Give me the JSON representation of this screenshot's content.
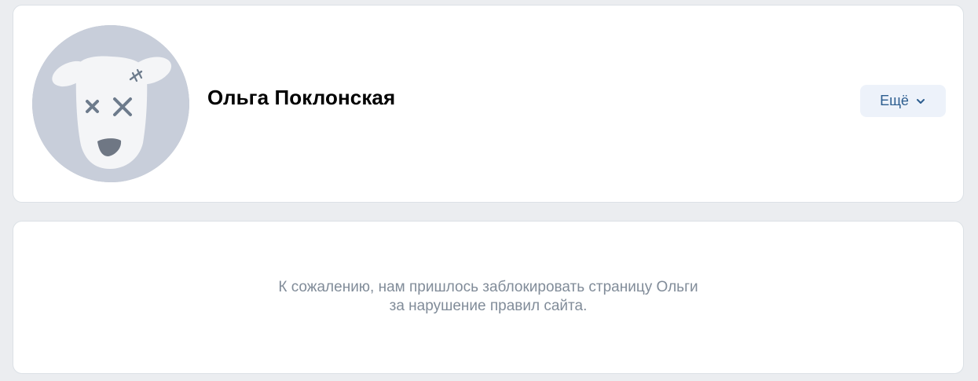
{
  "profile": {
    "name": "Ольга Поклонская",
    "avatar_icon": "blocked-dog-avatar-icon",
    "more_button_label": "Ещё",
    "more_button_icon": "chevron-down-icon"
  },
  "blocked_notice": {
    "line1": "К сожалению, нам пришлось заблокировать страницу Ольги",
    "line2": "за нарушение правил сайта."
  },
  "colors": {
    "page_background": "#ebedf0",
    "card_background": "#ffffff",
    "avatar_background": "#c8ceda",
    "button_background": "#edf2fa",
    "button_text": "#2c5d8f",
    "muted_text": "#818c99"
  }
}
